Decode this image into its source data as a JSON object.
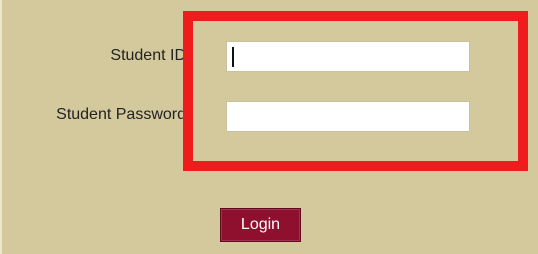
{
  "form": {
    "student_id_label": "Student ID",
    "student_password_label": "Student Password",
    "student_id_value": "",
    "student_password_value": "",
    "login_label": "Login"
  },
  "colors": {
    "background": "#d4c99d",
    "highlight": "#ee1c1c",
    "button": "#8f0f2e"
  }
}
